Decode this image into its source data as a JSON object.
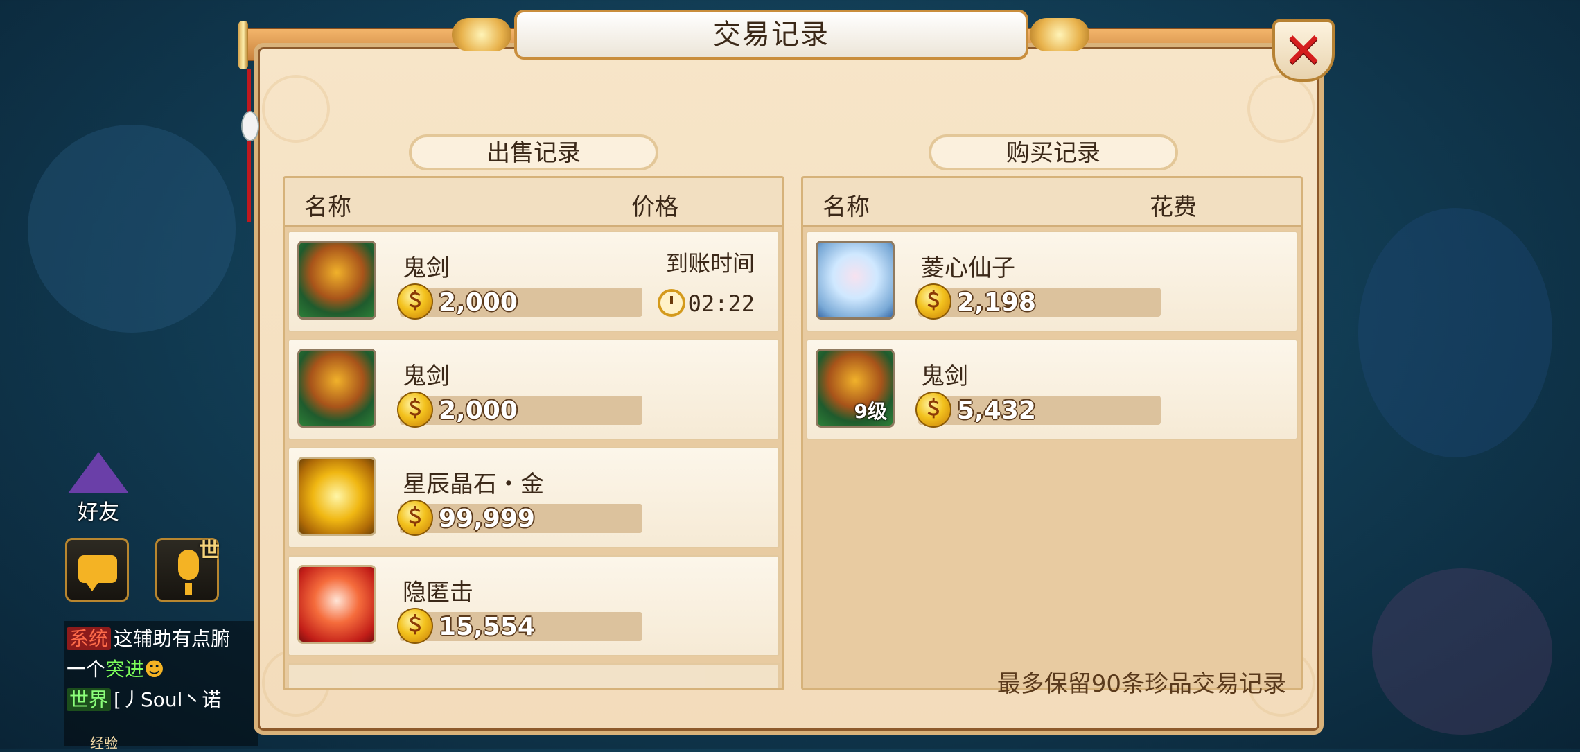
{
  "window": {
    "title": "交易记录"
  },
  "sell": {
    "header": "出售记录",
    "col_name": "名称",
    "col_price": "价格",
    "arrival_label": "到账时间",
    "items": [
      {
        "name": "鬼剑",
        "price": "2,000",
        "timer": "02:22",
        "icon": "ghost-sword-mask-icon"
      },
      {
        "name": "鬼剑",
        "price": "2,000",
        "icon": "ghost-sword-mask-icon"
      },
      {
        "name": "星辰晶石・金",
        "price": "99,999",
        "icon": "gold-star-crystal-icon"
      },
      {
        "name": "隐匿击",
        "price": "15,554",
        "icon": "stealth-strike-skill-icon"
      }
    ]
  },
  "buy": {
    "header": "购买记录",
    "col_name": "名称",
    "col_cost": "花费",
    "items": [
      {
        "name": "菱心仙子",
        "price": "2,198",
        "icon": "fairy-portrait-icon"
      },
      {
        "name": "鬼剑",
        "price": "5,432",
        "badge": "9级",
        "icon": "ghost-sword-mask-icon"
      }
    ]
  },
  "footer_note": "最多保留90条珍品交易记录",
  "hud": {
    "friends_label": "好友",
    "voice_badge": "世",
    "chat": [
      {
        "channel": "系统",
        "text": "这辅助有点腑"
      },
      {
        "text": "一个",
        "highlight": "突进"
      },
      {
        "channel": "世界",
        "text": "[丿Soul丶诺"
      }
    ],
    "exp_label": "经验"
  },
  "colors": {
    "accent": "#d9b27a",
    "close": "#d41d1d",
    "coin": "#f3c21e"
  }
}
